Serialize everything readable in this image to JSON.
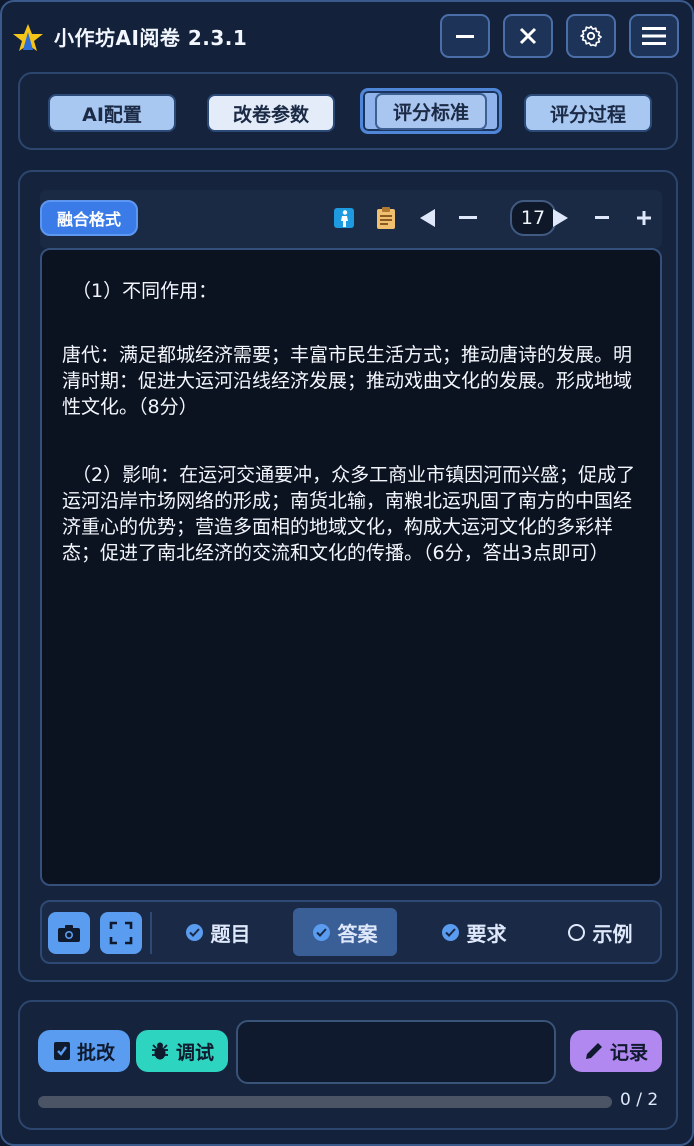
{
  "app": {
    "title": "小作坊AI阅卷 2.3.1"
  },
  "titlebar": {
    "icons": [
      "minimize-icon",
      "close-icon",
      "gear-icon",
      "menu-icon"
    ]
  },
  "tabs": [
    {
      "label": "AI配置"
    },
    {
      "label": "改卷参数"
    },
    {
      "label": "评分标准",
      "active": true
    },
    {
      "label": "评分过程"
    }
  ],
  "toolbar": {
    "format_label": "融合格式",
    "page": "17",
    "icons": [
      "person-icon",
      "clipboard-icon",
      "prev-icon",
      "minus-icon",
      "next-icon",
      "zoom-out-icon",
      "zoom-in-icon"
    ]
  },
  "content": {
    "paragraphs": [
      "（1）不同作用：",
      "唐代：满足都城经济需要；丰富市民生活方式；推动唐诗的发展。明清时期：促进大运河沿线经济发展；推动戏曲文化的发展。形成地域性文化。（8分）",
      "（2）影响：在运河交通要冲，众多工商业市镇因河而兴盛；促成了运河沿岸市场网络的形成；南货北输，南粮北运巩固了南方的中国经济重心的优势；营造多面相的地域文化，构成大运河文化的多彩样态；促进了南北经济的交流和文化的传播。（6分，答出3点即可）"
    ]
  },
  "segments": [
    {
      "label": "题目",
      "checked": true,
      "active": false
    },
    {
      "label": "答案",
      "checked": true,
      "active": true
    },
    {
      "label": "要求",
      "checked": true,
      "active": false
    },
    {
      "label": "示例",
      "checked": false,
      "active": false
    }
  ],
  "footer": {
    "grade_label": "批改",
    "debug_label": "调试",
    "record_label": "记录",
    "progress_text": "0 / 2",
    "progress_fraction": 0
  },
  "colors": {
    "accent": "#5a9cf0",
    "debug": "#2dd4bf",
    "record": "#b187f0",
    "background": "#13213a"
  }
}
